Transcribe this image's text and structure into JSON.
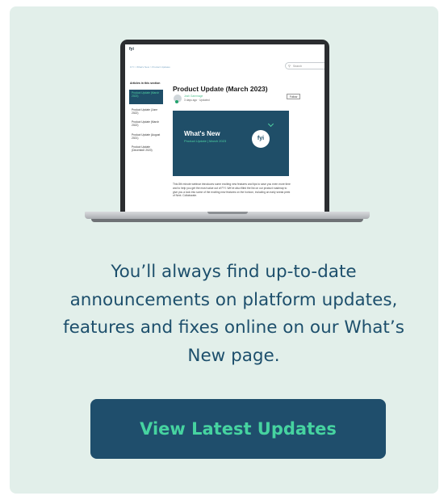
{
  "screen_page": {
    "logo": "fyi",
    "breadcrumb": "FYI  >  What's New  >  Product Updates",
    "search_placeholder": "Search",
    "sidebar_title": "Articles in this section",
    "sidebar_items": [
      "Product Update (March 2023)",
      "Product Update (June 2022)",
      "Product Update (March 2022)",
      "Product Update (August 2021)",
      "Product Update (December 2020)"
    ],
    "article_title": "Product Update (March 2023)",
    "author": "Josh Gammage",
    "meta": "3 days ago · Updated",
    "follow_label": "Follow",
    "banner_title": "What's New",
    "banner_subtitle": "Product Update | March 2023",
    "banner_logo": "fyi",
    "body_text": "This 8th minute webinar introduces some exciting new features and tips to save you even more time and to help you get the most value out of FYI. We've also filled the list on our product roadmap to give you a look into some of the exciting new features on the horizon, including an early sneak peek of Next. Collaborate."
  },
  "message": "You’ll always find up-to-date announcements on platform updates, features and fixes online on our What’s New page.",
  "cta_label": "View Latest Updates",
  "colors": {
    "card_background": "#e2efea",
    "text_navy": "#1d4f6c",
    "button_background": "#1f4e6c",
    "button_text": "#46d3a0"
  }
}
